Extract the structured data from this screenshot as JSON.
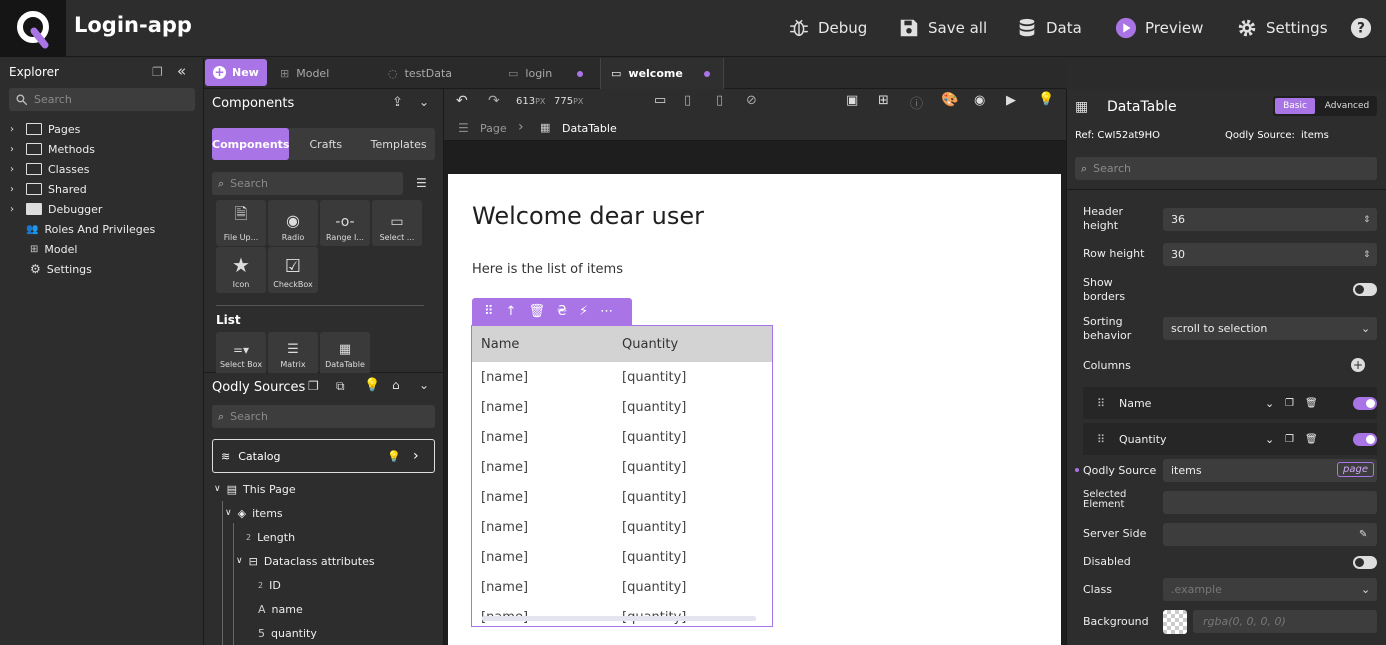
{
  "app": {
    "title": "Login-app"
  },
  "topbar": {
    "debug": "Debug",
    "save_all": "Save all",
    "data": "Data",
    "preview": "Preview",
    "settings": "Settings"
  },
  "explorer": {
    "title": "Explorer",
    "search_placeholder": "Search",
    "items": [
      "Pages",
      "Methods",
      "Classes",
      "Shared",
      "Debugger",
      "Roles And Privileges",
      "Model",
      "Settings"
    ]
  },
  "tabs": {
    "new": "New",
    "items": [
      "Model",
      "testData",
      "login",
      "welcome"
    ]
  },
  "components": {
    "title": "Components",
    "segments": [
      "Components",
      "Crafts",
      "Templates"
    ],
    "search_placeholder": "Search",
    "tiles_row1": [
      "File Up...",
      "Radio",
      "Range I...",
      "Select ..."
    ],
    "tiles_row2": [
      "Icon",
      "CheckBox"
    ],
    "list_heading": "List",
    "tiles_row3": [
      "Select Box",
      "Matrix",
      "DataTable"
    ]
  },
  "qodly_sources": {
    "title": "Qodly Sources",
    "search_placeholder": "Search",
    "catalog": "Catalog",
    "tree": [
      "This Page",
      "items",
      "Length",
      "Dataclass attributes",
      "ID",
      "name",
      "quantity"
    ],
    "type_markers": [
      "2",
      "2",
      "A",
      "5"
    ]
  },
  "editor": {
    "width": "613",
    "height": "775",
    "unit": "PX",
    "breadcrumb": [
      "Page",
      "DataTable"
    ]
  },
  "page": {
    "heading": "Welcome dear user",
    "subtext": "Here is the list of items",
    "table": {
      "headers": [
        "Name",
        "Quantity"
      ],
      "rows": [
        [
          "[name]",
          "[quantity]"
        ],
        [
          "[name]",
          "[quantity]"
        ],
        [
          "[name]",
          "[quantity]"
        ],
        [
          "[name]",
          "[quantity]"
        ],
        [
          "[name]",
          "[quantity]"
        ],
        [
          "[name]",
          "[quantity]"
        ],
        [
          "[name]",
          "[quantity]"
        ],
        [
          "[name]",
          "[quantity]"
        ],
        [
          "[name]",
          "[quantity]"
        ]
      ]
    }
  },
  "properties": {
    "title": "DataTable",
    "tab_basic": "Basic",
    "tab_advanced": "Advanced",
    "ref": "Ref: CwI52at9HO",
    "qodly_source_label": "Qodly Source:",
    "qodly_source_value": "items",
    "search_placeholder": "Search",
    "header_height_label": "Header height",
    "header_height": "36",
    "row_height_label": "Row height",
    "row_height": "30",
    "show_borders_label": "Show borders",
    "sorting_label": "Sorting behavior",
    "sorting_value": "scroll to selection",
    "columns_label": "Columns",
    "columns": [
      "Name",
      "Quantity"
    ],
    "qodly_source_field_label": "Qodly Source",
    "qodly_source_field": "items",
    "page_badge": "page",
    "selected_element_label": "Selected Element",
    "server_side_label": "Server Side",
    "disabled_label": "Disabled",
    "class_label": "Class",
    "class_placeholder": ".example",
    "background_label": "Background",
    "background_placeholder": "rgba(0, 0, 0, 0)"
  },
  "colors": {
    "accent": "#a974e6",
    "panel": "#2d2d2d",
    "yellow": "#f2c12e"
  }
}
